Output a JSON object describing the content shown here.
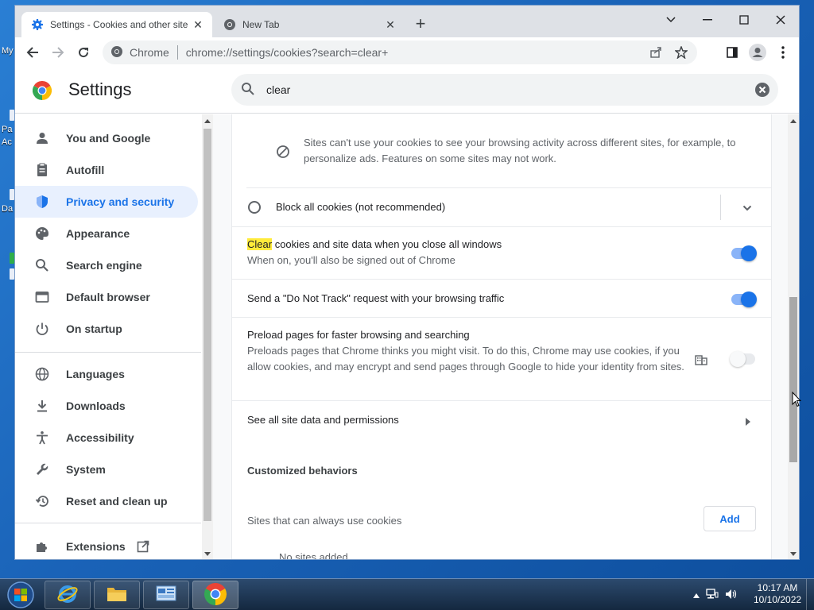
{
  "browser": {
    "tabs": [
      {
        "title": "Settings - Cookies and other site",
        "icon": "gear-icon",
        "active": true
      },
      {
        "title": "New Tab",
        "icon": "chrome-icon",
        "active": false
      }
    ],
    "omnibox_label": "Chrome",
    "url": "chrome://settings/cookies?search=clear+"
  },
  "settings": {
    "title": "Settings",
    "search_value": "clear",
    "nav": [
      {
        "label": "You and Google",
        "icon": "person-icon"
      },
      {
        "label": "Autofill",
        "icon": "clipboard-icon"
      },
      {
        "label": "Privacy and security",
        "icon": "shield-icon",
        "selected": true
      },
      {
        "label": "Appearance",
        "icon": "palette-icon"
      },
      {
        "label": "Search engine",
        "icon": "search-icon"
      },
      {
        "label": "Default browser",
        "icon": "browser-icon"
      },
      {
        "label": "On startup",
        "icon": "power-icon"
      },
      {
        "label": "Languages",
        "icon": "globe-icon"
      },
      {
        "label": "Downloads",
        "icon": "download-icon"
      },
      {
        "label": "Accessibility",
        "icon": "accessibility-icon"
      },
      {
        "label": "System",
        "icon": "wrench-icon"
      },
      {
        "label": "Reset and clean up",
        "icon": "restore-icon"
      },
      {
        "label": "Extensions",
        "icon": "puzzle-icon"
      }
    ],
    "content": {
      "third_party_desc": "Sites can't use your cookies to see your browsing activity across different sites, for example, to personalize ads. Features on some sites may not work.",
      "block_all": "Block all cookies (not recommended)",
      "clear_on_close_highlight": "Clear",
      "clear_on_close_rest": " cookies and site data when you close all windows",
      "clear_on_close_sub": "When on, you'll also be signed out of Chrome",
      "clear_on_close_enabled": true,
      "dnt_label": "Send a \"Do Not Track\" request with your browsing traffic",
      "dnt_enabled": true,
      "preload_title": "Preload pages for faster browsing and searching",
      "preload_desc": "Preloads pages that Chrome thinks you might visit. To do this, Chrome may use cookies, if you allow cookies, and may encrypt and send pages through Google to hide your identity from sites.",
      "preload_enabled": false,
      "see_all": "See all site data and permissions",
      "customized_heading": "Customized behaviors",
      "always_allow_label": "Sites that can always use cookies",
      "add_label": "Add",
      "no_sites": "No sites added"
    }
  },
  "desktop_fragments": [
    "My",
    "Pa",
    "Ac",
    "Da"
  ],
  "taskbar": {
    "apps": [
      "internet-explorer",
      "file-explorer",
      "control-panel",
      "chrome"
    ],
    "time": "10:17 AM",
    "date": "10/10/2022"
  },
  "colors": {
    "accent": "#1a73e8",
    "selected_nav_bg": "#e8f0fe",
    "highlight": "#ffeb3b"
  }
}
